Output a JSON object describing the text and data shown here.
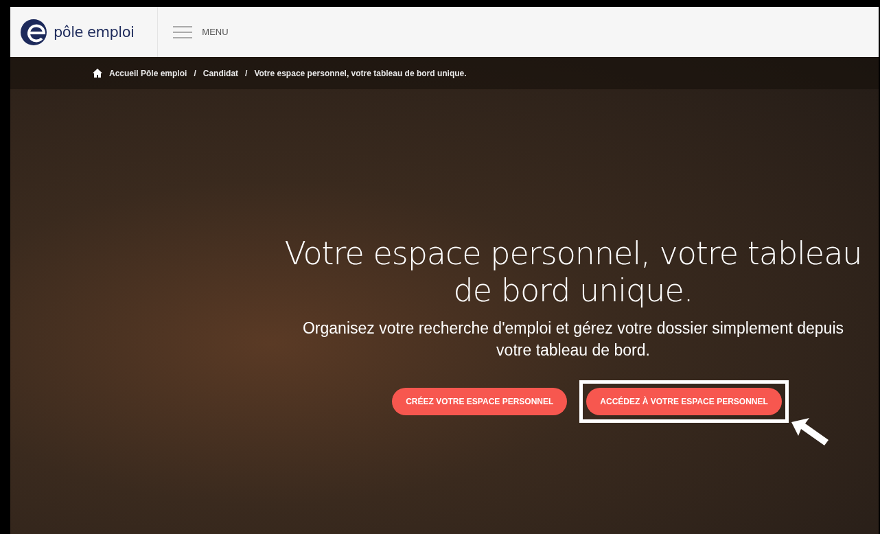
{
  "header": {
    "logo_text": "pôle emploi",
    "menu_label": "MENU"
  },
  "breadcrumb": [
    "Accueil Pôle emploi",
    "Candidat",
    "Votre espace personnel, votre tableau de bord unique."
  ],
  "breadcrumb_separator": "/",
  "hero": {
    "title": "Votre espace personnel, votre tableau de bord unique.",
    "subtitle": "Organisez votre recherche d'emploi et gérez votre dossier simplement depuis votre tableau de bord."
  },
  "buttons": [
    {
      "label": "CRÉEZ VOTRE ESPACE PERSONNEL",
      "highlighted": false
    },
    {
      "label": "ACCÉDEZ À VOTRE ESPACE PERSONNEL",
      "highlighted": true
    }
  ]
}
